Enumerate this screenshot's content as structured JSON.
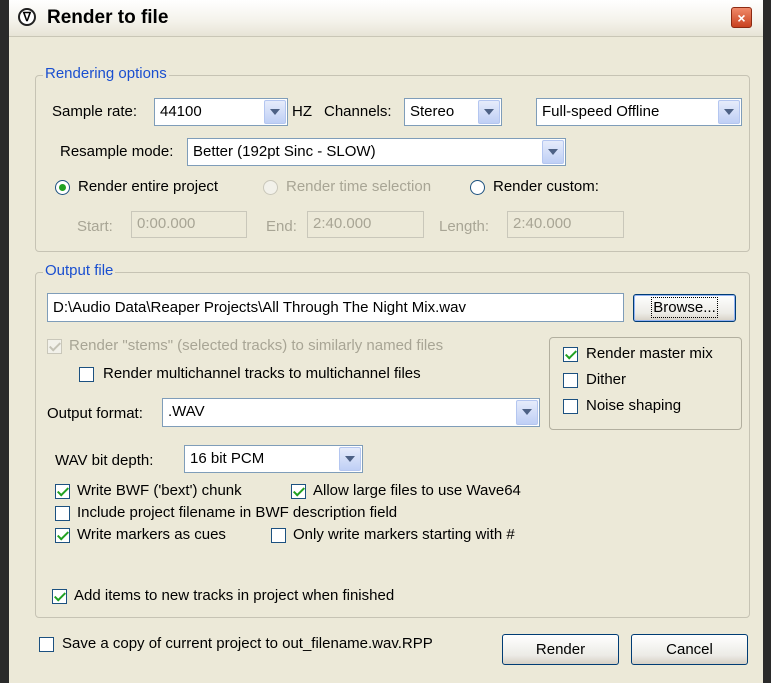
{
  "window": {
    "title": "Render to file",
    "close_glyph": "×"
  },
  "rendering_options": {
    "group_label": "Rendering options",
    "sample_rate_label": "Sample rate:",
    "sample_rate_value": "44100",
    "hz_label": "HZ",
    "channels_label": "Channels:",
    "channels_value": "Stereo",
    "render_speed_value": "Full-speed Offline",
    "resample_label": "Resample mode:",
    "resample_value": "Better (192pt Sinc - SLOW)",
    "bounds": {
      "entire_project_label": "Render entire project",
      "entire_project_selected": true,
      "time_selection_label": "Render time selection",
      "custom_label": "Render custom:"
    },
    "start_label": "Start:",
    "start_value": "0:00.000",
    "end_label": "End:",
    "end_value": "2:40.000",
    "length_label": "Length:",
    "length_value": "2:40.000"
  },
  "output_file": {
    "group_label": "Output file",
    "path_value": "D:\\Audio Data\\Reaper Projects\\All Through The Night Mix.wav",
    "browse_label": "Browse...",
    "stems_label": "Render \"stems\" (selected tracks) to similarly named files",
    "stems_checked": true,
    "multichannel_label": "Render multichannel tracks to multichannel files",
    "multichannel_checked": false,
    "master_mix_label": "Render master mix",
    "master_mix_checked": true,
    "dither_label": "Dither",
    "dither_checked": false,
    "noise_shaping_label": "Noise shaping",
    "noise_shaping_checked": false,
    "format_label": "Output format:",
    "format_value": ".WAV",
    "wav_bit_depth_label": "WAV bit depth:",
    "wav_bit_depth_value": "16 bit PCM",
    "bwf_label": "Write BWF ('bext') chunk",
    "bwf_checked": true,
    "wave64_label": "Allow large files to use Wave64",
    "wave64_checked": true,
    "include_filename_label": "Include project filename in BWF description field",
    "include_filename_checked": false,
    "markers_cues_label": "Write markers as cues",
    "markers_cues_checked": true,
    "markers_hash_label": "Only write markers starting with #",
    "markers_hash_checked": false,
    "add_items_label": "Add items to new tracks in project when finished",
    "add_items_checked": true
  },
  "footer": {
    "save_copy_label": "Save a copy of current project to out_filename.wav.RPP",
    "save_copy_checked": false,
    "render_label": "Render",
    "cancel_label": "Cancel"
  },
  "icons": {
    "app": "reaper-logo-icon",
    "close": "close-icon",
    "dropdown": "chevron-down-icon"
  },
  "colors": {
    "dialog_bg": "#ece9d8",
    "group_label": "#1a4fd0",
    "check_mark": "#21a121",
    "disabled_text": "#a8a595"
  }
}
